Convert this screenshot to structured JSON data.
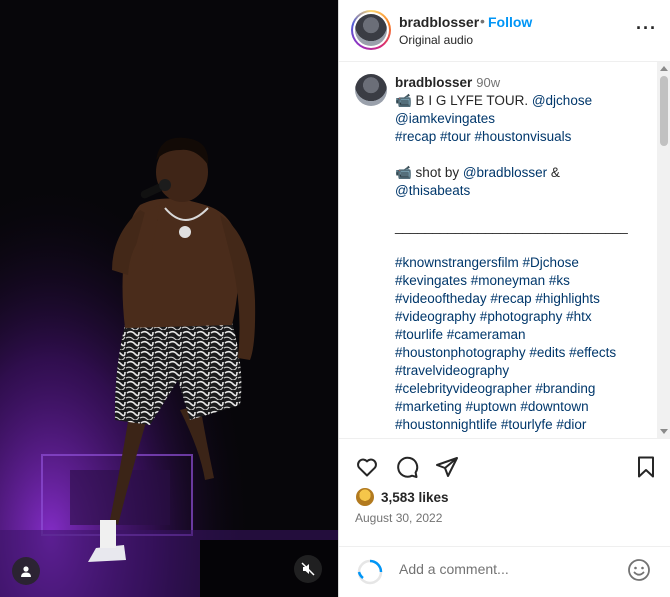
{
  "header": {
    "username": "bradblosser",
    "separator": "•",
    "follow_label": "Follow",
    "audio_label": "Original audio",
    "more_label": "···"
  },
  "caption": {
    "username": "bradblosser",
    "time": "90w",
    "lines": [
      {
        "text": "📹 B I G LYFE TOUR. ",
        "link": "@djchose"
      },
      {
        "text": "",
        "link": "@iamkevingates"
      },
      {
        "text": "",
        "link": "#recap #tour #houstonvisuals"
      },
      {
        "text": "",
        "link": ""
      },
      {
        "text": "📹 shot by ",
        "link": "@bradblosser",
        "after": " &"
      },
      {
        "text": "",
        "link": "@thisabeats"
      },
      {
        "text": "",
        "link": ""
      },
      {
        "text": "_______________________________",
        "link": ""
      },
      {
        "text": "",
        "link": ""
      },
      {
        "text": "",
        "link": "#knownstrangersfilm #Djchose"
      },
      {
        "text": "",
        "link": "#kevingates #moneyman #ks"
      },
      {
        "text": "",
        "link": "#videooftheday #recap #highlights"
      },
      {
        "text": "",
        "link": "#videography #photography #htx"
      },
      {
        "text": "",
        "link": "#tourlife #cameraman"
      },
      {
        "text": "",
        "link": "#houstonphotography #edits #effects"
      },
      {
        "text": "",
        "link": "#travelvideography"
      },
      {
        "text": "",
        "link": "#celebrityvideographer #branding"
      },
      {
        "text": "",
        "link": "#marketing #uptown #downtown"
      },
      {
        "text": "",
        "link": "#houstonnightlife #tourlyfe #dior"
      }
    ]
  },
  "actions": {
    "like_icon": "heart-icon",
    "comment_icon": "comment-icon",
    "share_icon": "share-icon",
    "save_icon": "bookmark-icon",
    "likes_count": "3,583 likes",
    "date": "August 30, 2022"
  },
  "add_comment": {
    "placeholder": "Add a comment...",
    "emoji_icon": "emoji-icon"
  },
  "media": {
    "tag_icon": "user-tag-icon",
    "mute_icon": "muted-speaker-icon"
  },
  "colors": {
    "accent": "#0095f6",
    "link": "#00376b",
    "muted": "#737373"
  }
}
